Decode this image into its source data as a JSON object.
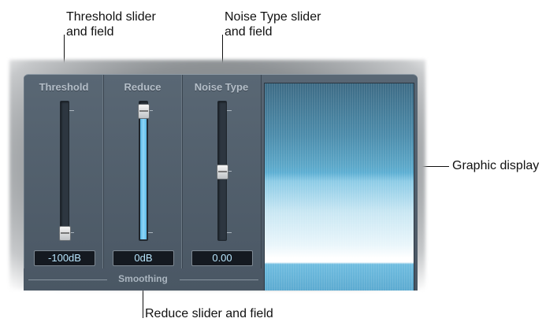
{
  "callouts": {
    "threshold": [
      "Threshold slider",
      "and field"
    ],
    "noise_type": [
      "Noise Type slider",
      "and field"
    ],
    "graphic": "Graphic display",
    "reduce": "Reduce slider and field"
  },
  "plugin": {
    "columns": [
      {
        "label": "Threshold",
        "value": "-100dB",
        "level": 0.0
      },
      {
        "label": "Reduce",
        "value": "0dB",
        "level": 1.0
      },
      {
        "label": "Noise Type",
        "value": "0.00",
        "level": 0.5
      }
    ],
    "smoothing_label": "Smoothing"
  },
  "colors": {
    "panel": "#4f5c69",
    "accent_fill": "#6fc6ef",
    "field_text": "#b7e4fb"
  }
}
